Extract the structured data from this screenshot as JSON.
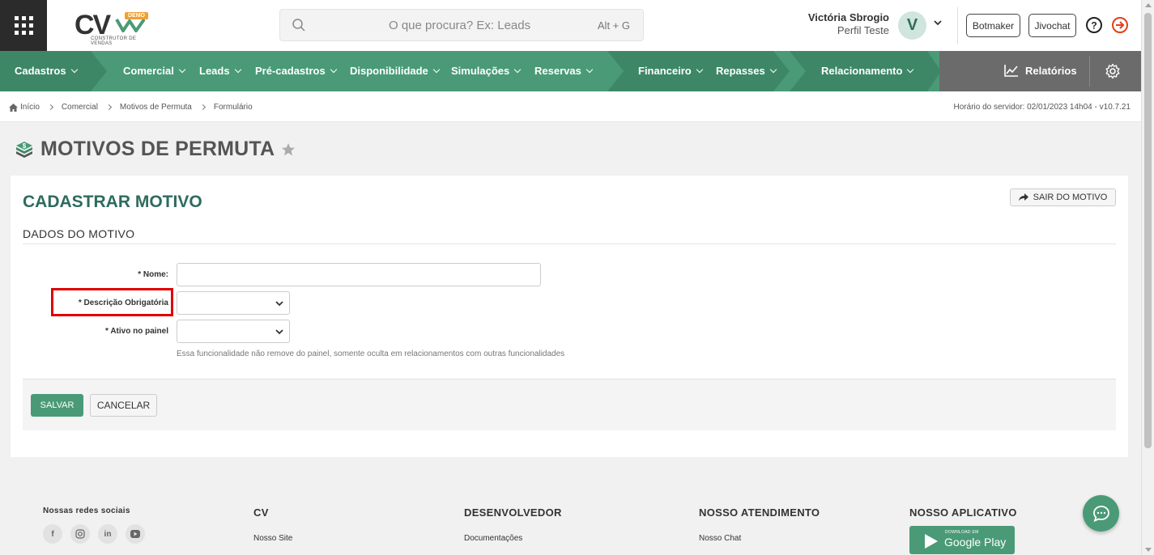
{
  "header": {
    "logo_text": "CV",
    "logo_badge": "DEMO",
    "logo_subtitle": "CONSTRUTOR DE VENDAS",
    "search_placeholder": "O que procura? Ex: Leads",
    "search_shortcut": "Alt + G",
    "user_name": "Victória Sbrogio",
    "user_profile": "Perfil Teste",
    "avatar_letter": "V",
    "botmaker_label": "Botmaker",
    "jivochat_label": "Jivochat"
  },
  "nav": {
    "items": [
      {
        "label": "Cadastros"
      },
      {
        "label": "Comercial"
      },
      {
        "label": "Leads"
      },
      {
        "label": "Pré-cadastros"
      },
      {
        "label": "Disponibilidade"
      },
      {
        "label": "Simulações"
      },
      {
        "label": "Reservas"
      },
      {
        "label": "Financeiro"
      },
      {
        "label": "Repasses"
      },
      {
        "label": "Relacionamento"
      }
    ],
    "reports_label": "Relatórios",
    "colors": {
      "primary": "#4a9a77",
      "dark": "#3d8767",
      "gray": "#6b6b6b"
    }
  },
  "breadcrumb": {
    "items": [
      "Início",
      "Comercial",
      "Motivos de Permuta",
      "Formulário"
    ],
    "server_time": "Horário do servidor: 02/01/2023 14h04 - v10.7.21"
  },
  "page": {
    "title": "MOTIVOS DE PERMUTA"
  },
  "form": {
    "card_title": "CADASTRAR MOTIVO",
    "exit_label": "SAIR DO MOTIVO",
    "section_title": "DADOS DO MOTIVO",
    "fields": {
      "name_label": "* Nome:",
      "name_value": "",
      "desc_label": "* Descrição Obrigatória",
      "desc_value": "",
      "active_label": "* Ativo no painel",
      "active_value": "",
      "active_help": "Essa funcionalidade não remove do painel, somente oculta em relacionamentos com outras funcionalidades"
    },
    "save_label": "SALVAR",
    "cancel_label": "CANCELAR"
  },
  "footer": {
    "social_title": "Nossas redes sociais",
    "social_icons": [
      "facebook-icon",
      "instagram-icon",
      "linkedin-icon",
      "youtube-icon"
    ],
    "col_cv_title": "CV",
    "col_cv_link": "Nosso Site",
    "col_dev_title": "DESENVOLVEDOR",
    "col_dev_link": "Documentações",
    "col_support_title": "NOSSO ATENDIMENTO",
    "col_support_link": "Nosso Chat",
    "col_app_title": "NOSSO APLICATIVO",
    "gplay_small": "DOWNLOAD EM",
    "gplay_big": "Google Play"
  }
}
